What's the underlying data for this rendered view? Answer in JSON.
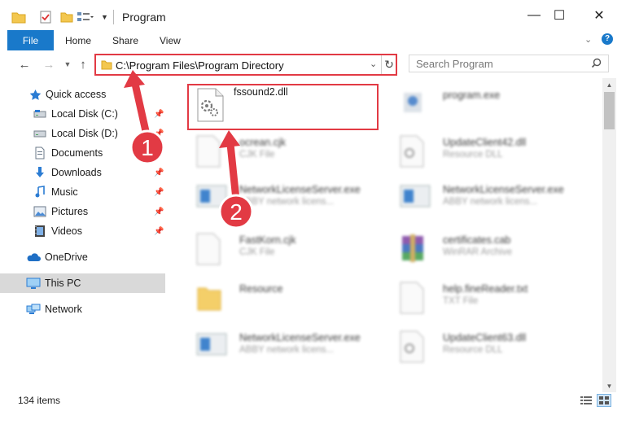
{
  "window": {
    "title": "Program"
  },
  "window_controls": {
    "minimize": "—",
    "maximize": "☐",
    "close": "✕"
  },
  "ribbon": {
    "file": "File",
    "home": "Home",
    "share": "Share",
    "view": "View",
    "help": "?"
  },
  "address_bar": {
    "path": "C:\\Program Files\\Program Directory"
  },
  "search": {
    "placeholder": "Search Program"
  },
  "sidebar": {
    "items": [
      {
        "label": "Quick access",
        "icon": "star-icon"
      },
      {
        "label": "Local Disk (C:)",
        "icon": "drive-icon"
      },
      {
        "label": "Local Disk (D:)",
        "icon": "drive-icon"
      },
      {
        "label": "Documents",
        "icon": "documents-icon"
      },
      {
        "label": "Downloads",
        "icon": "downloads-icon"
      },
      {
        "label": "Music",
        "icon": "music-icon"
      },
      {
        "label": "Pictures",
        "icon": "pictures-icon"
      },
      {
        "label": "Videos",
        "icon": "videos-icon"
      },
      {
        "label": "OneDrive",
        "icon": "cloud-icon"
      },
      {
        "label": "This PC",
        "icon": "computer-icon"
      },
      {
        "label": "Network",
        "icon": "network-icon"
      }
    ]
  },
  "files": [
    {
      "name": "fssound2.dll",
      "type": "",
      "icon": "dll-gear-icon"
    },
    {
      "name": "program.exe",
      "type": "",
      "icon": "exe-icon"
    },
    {
      "name": "ocrean.cjk",
      "type": "CJK File",
      "icon": "blank-file-icon"
    },
    {
      "name": "UpdateClient42.dll",
      "type": "Resource DLL",
      "icon": "dll-gear-icon"
    },
    {
      "name": "NetworkLicenseServer.exe",
      "type": "ABBY network licens...",
      "icon": "app-window-icon"
    },
    {
      "name": "NetworkLicenseServer.exe",
      "type": "ABBY network licens...",
      "icon": "app-window-icon"
    },
    {
      "name": "FastKorn.cjk",
      "type": "CJK File",
      "icon": "blank-file-icon"
    },
    {
      "name": "certificates.cab",
      "type": "WinRAR Archive",
      "icon": "archive-icon"
    },
    {
      "name": "Resource",
      "type": "",
      "icon": "folder-icon"
    },
    {
      "name": "help.fineReader.txt",
      "type": "TXT File",
      "icon": "blank-file-icon"
    },
    {
      "name": "NetworkLicenseServer.exe",
      "type": "ABBY network licens...",
      "icon": "app-window-icon"
    },
    {
      "name": "UpdateClient63.dll",
      "type": "Resource DLL",
      "icon": "dll-gear-icon"
    }
  ],
  "annotations": {
    "step1": "1",
    "step2": "2"
  },
  "status": {
    "item_count": "134 items"
  },
  "colors": {
    "accent": "#1979ca",
    "highlight_red": "#e23a44",
    "selected_bg": "#d9d9d9"
  }
}
